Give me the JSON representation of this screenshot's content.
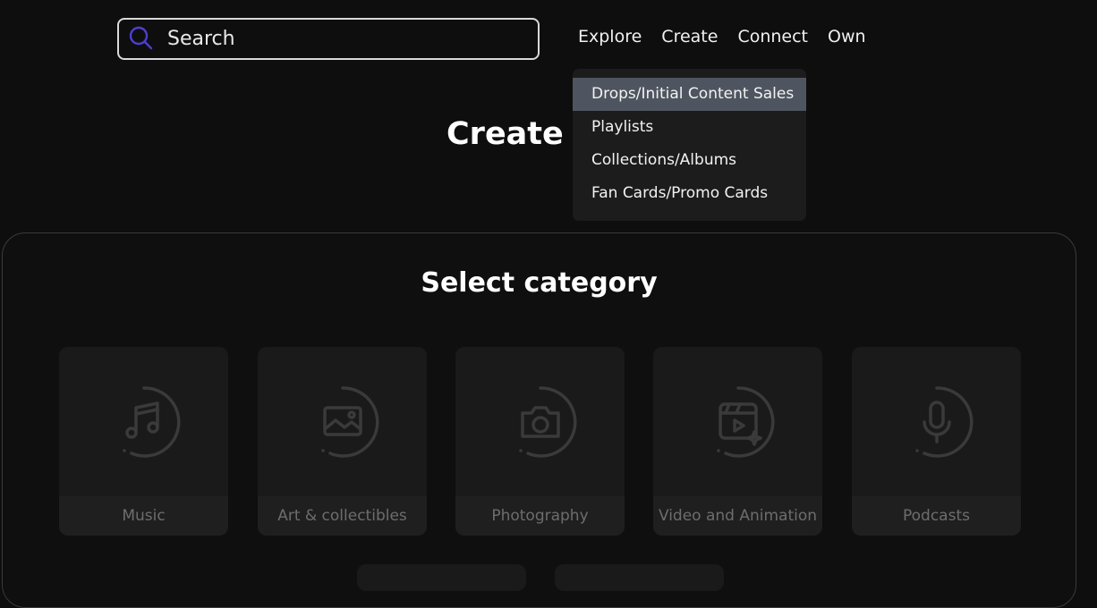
{
  "search": {
    "placeholder": "Search"
  },
  "nav": {
    "items": [
      "Explore",
      "Create",
      "Connect",
      "Own"
    ]
  },
  "dropdown": {
    "items": [
      "Drops/Initial Content Sales",
      "Playlists",
      "Collections/Albums",
      "Fan Cards/Promo Cards"
    ]
  },
  "page": {
    "title": "Create D"
  },
  "category": {
    "title": "Select category",
    "cards": [
      {
        "label": "Music",
        "icon": "music-note-icon"
      },
      {
        "label": "Art & collectibles",
        "icon": "image-icon"
      },
      {
        "label": "Photography",
        "icon": "camera-icon"
      },
      {
        "label": "Video and Animation",
        "icon": "video-icon"
      },
      {
        "label": "Podcasts",
        "icon": "microphone-icon"
      }
    ]
  },
  "colors": {
    "background": "#0e0e0e",
    "dropdown_bg": "#1c1c1c",
    "dropdown_active": "#4f5560",
    "search_icon": "#4b3fd1",
    "card_bg": "#1a1a1a"
  }
}
